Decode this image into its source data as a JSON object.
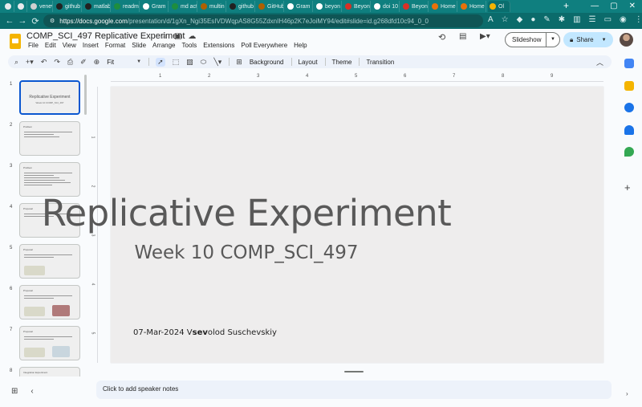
{
  "browser": {
    "tabs": [
      {
        "label": "",
        "color": "#e8eaed"
      },
      {
        "label": "",
        "color": "#e8eaed"
      },
      {
        "label": "venev",
        "color": "#d0d0d0"
      },
      {
        "label": "github",
        "color": "#222222"
      },
      {
        "label": "matlab",
        "color": "#222222"
      },
      {
        "label": "readm",
        "color": "#1e8e3e"
      },
      {
        "label": "Gram",
        "color": "#ffffff"
      },
      {
        "label": "md act",
        "color": "#1e8e3e"
      },
      {
        "label": "multin",
        "color": "#b06000"
      },
      {
        "label": "github",
        "color": "#222222"
      },
      {
        "label": "GitHub",
        "color": "#b06000"
      },
      {
        "label": "Gram",
        "color": "#ffffff"
      },
      {
        "label": "beyon",
        "color": "#ffffff"
      },
      {
        "label": "Beyon",
        "color": "#d93025"
      },
      {
        "label": "doi 10",
        "color": "#ffffff"
      },
      {
        "label": "Beyon",
        "color": "#d93025"
      },
      {
        "label": "Home",
        "color": "#e8710a"
      },
      {
        "label": "Home",
        "color": "#e8710a"
      },
      {
        "label": "Ol",
        "color": "#f4b400"
      }
    ],
    "new_tab": "+",
    "url_domain": "https://docs.google.com",
    "url_path": "/presentation/d/1gXn_Ngi35EsIVDWqpAS8G55ZdxnIH46p2K7eJoiMY94/edit#slide=id.g268dfd10c94_0_0"
  },
  "doc": {
    "title": "COMP_SCI_497 Replicative Experiment",
    "menu": [
      "File",
      "Edit",
      "View",
      "Insert",
      "Format",
      "Slide",
      "Arrange",
      "Tools",
      "Extensions",
      "Poll Everywhere",
      "Help"
    ],
    "slideshow_label": "Slideshow",
    "share_label": "Share"
  },
  "toolbar": {
    "zoom": "Fit",
    "background": "Background",
    "layout": "Layout",
    "theme": "Theme",
    "transition": "Transition"
  },
  "filmstrip": [
    {
      "num": "1",
      "big": "Replicative Experiment",
      "small": "Week 10 COMP_SCI_497"
    },
    {
      "num": "2",
      "tt": "Problem"
    },
    {
      "num": "3",
      "tt": "Problem"
    },
    {
      "num": "4",
      "tt": "Proposal"
    },
    {
      "num": "5",
      "tt": "Proposal"
    },
    {
      "num": "6",
      "tt": "Proposal"
    },
    {
      "num": "7",
      "tt": "Proposal"
    },
    {
      "num": "8",
      "tt": "Integration Experiment"
    }
  ],
  "rulers": {
    "h": [
      "1",
      "2",
      "3",
      "4",
      "5",
      "6",
      "7",
      "8",
      "9"
    ],
    "v": [
      "1",
      "2",
      "3",
      "4",
      "5"
    ]
  },
  "slide": {
    "title": "Replicative Experiment",
    "subtitle": "Week 10 COMP_SCI_497",
    "footer_pre": "07-Mar-2024 V",
    "footer_bold": "sev",
    "footer_post": "olod Suschevskiy"
  },
  "notes": {
    "placeholder": "Click to add speaker notes"
  }
}
